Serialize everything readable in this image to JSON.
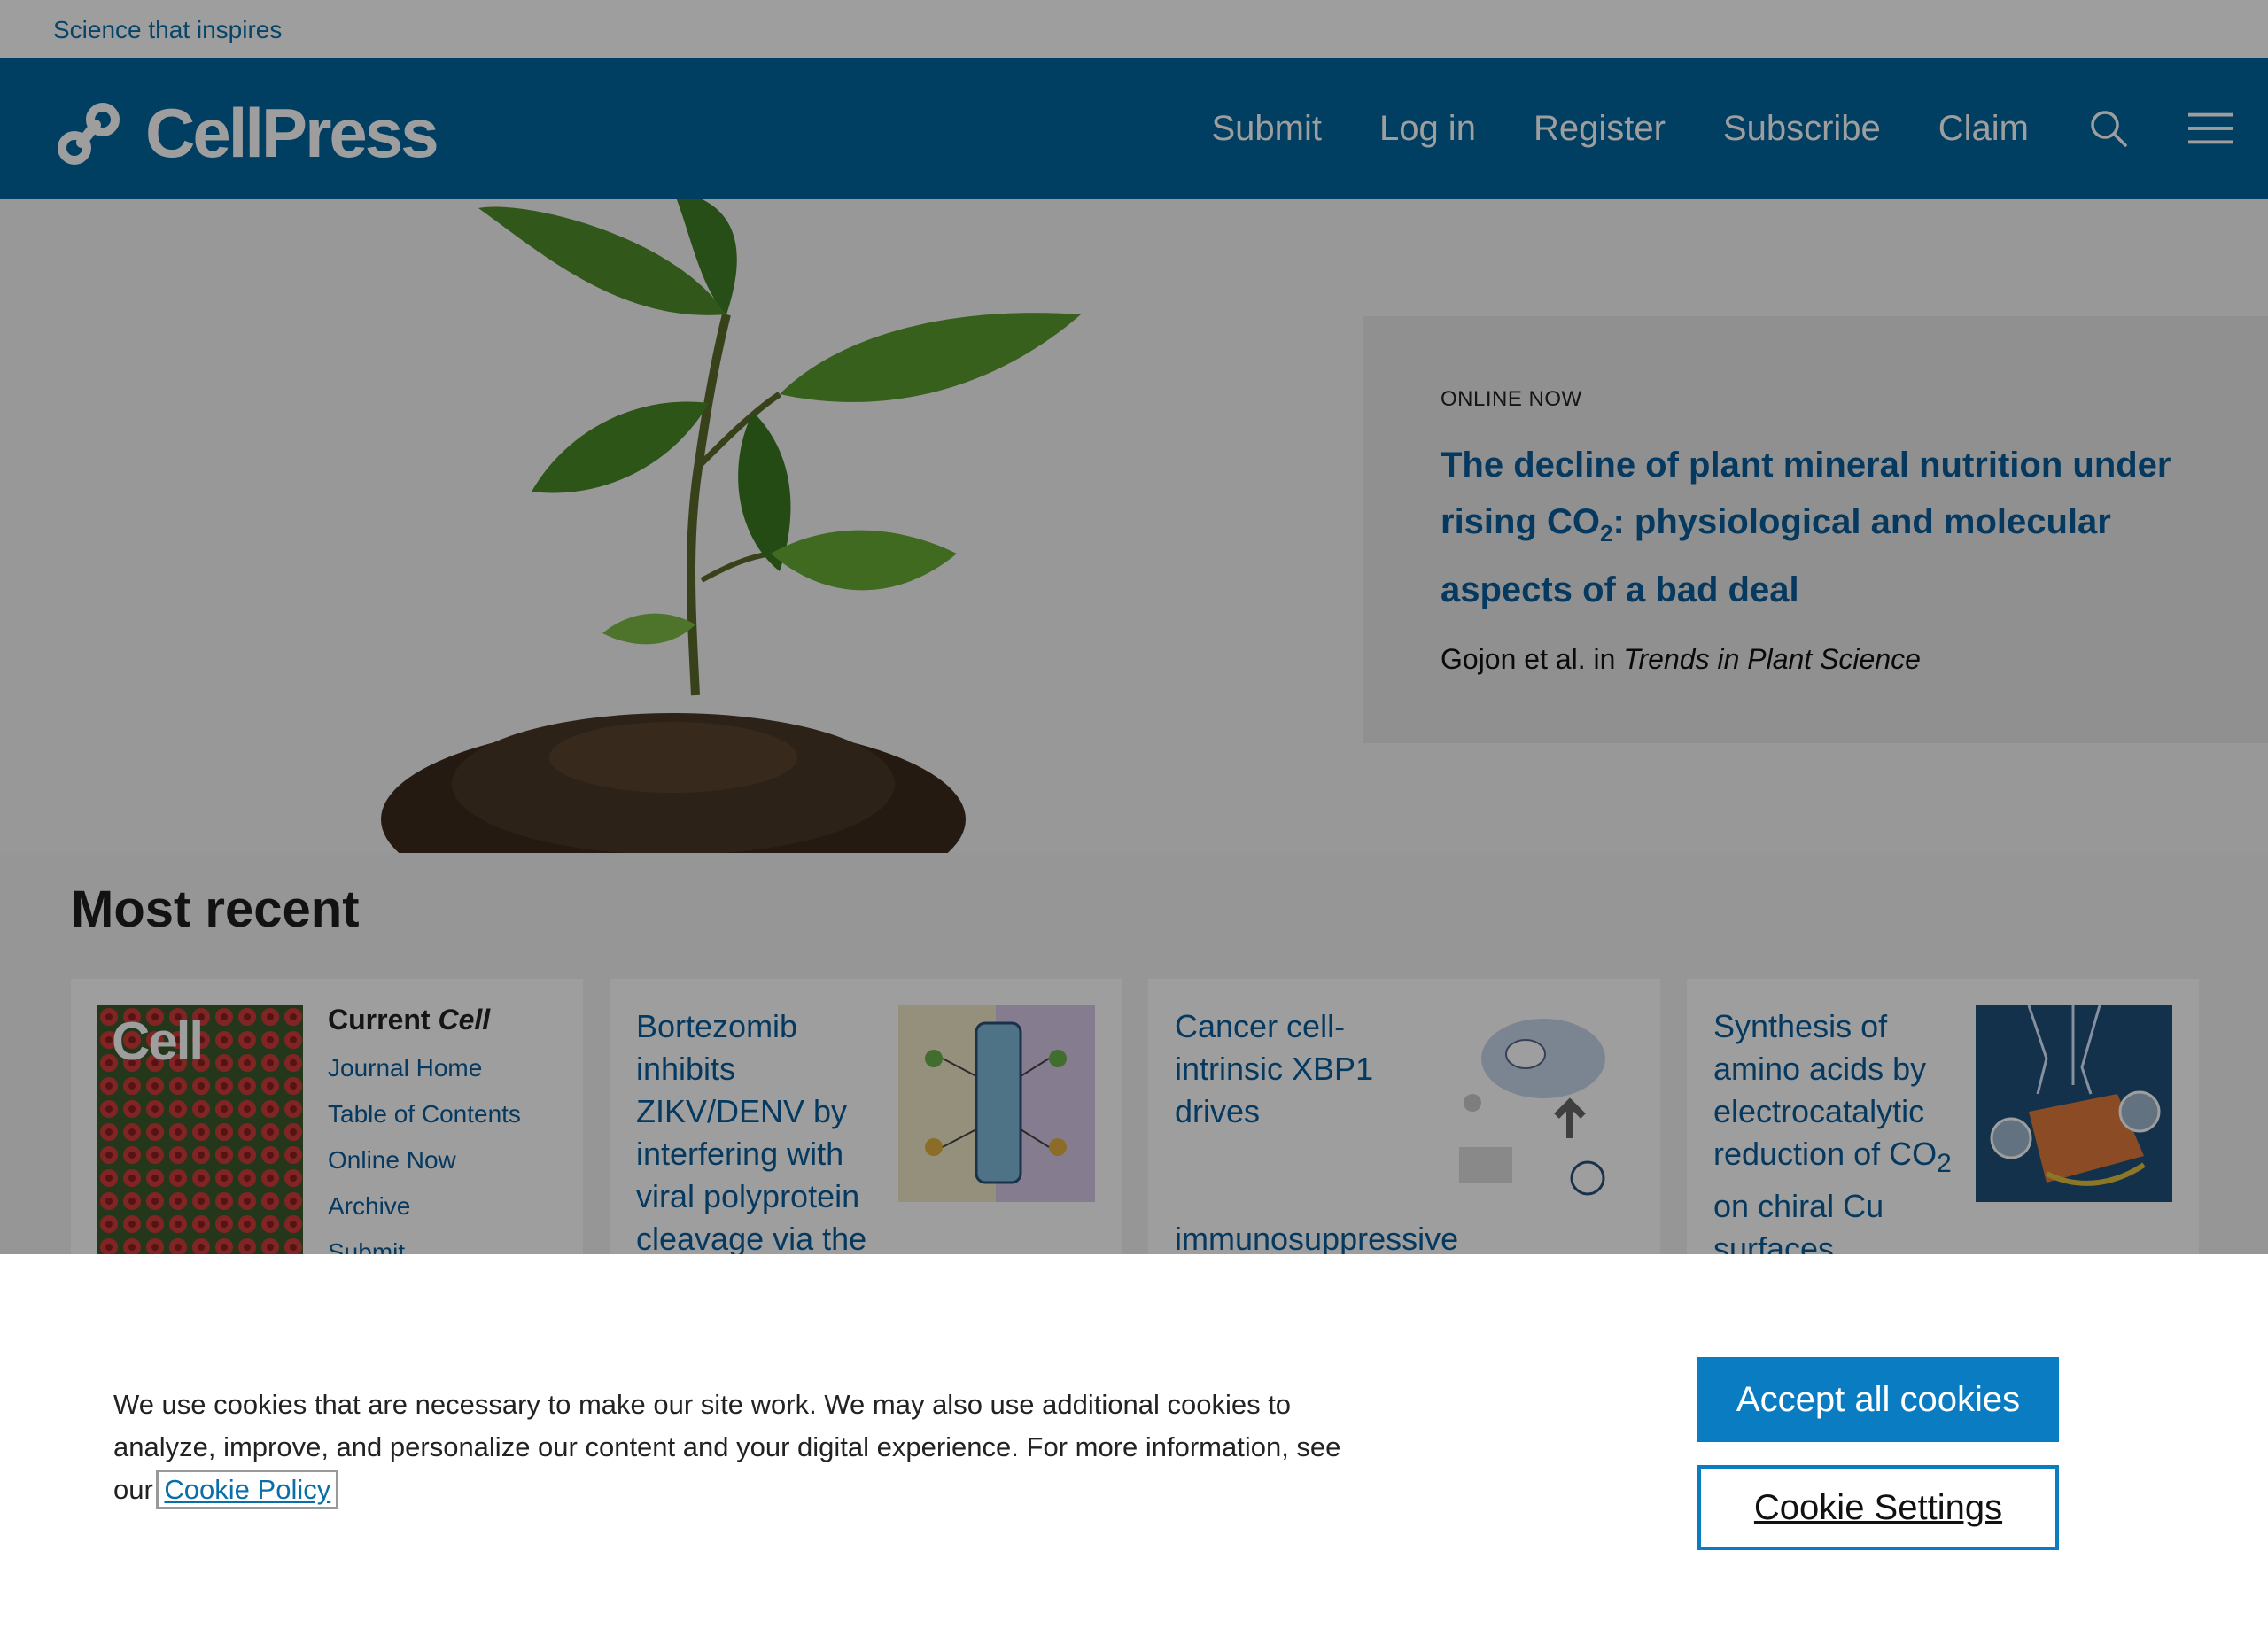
{
  "topbar": {
    "tagline": "Science that inspires"
  },
  "header": {
    "logo_text": "CellPress",
    "nav": [
      "Submit",
      "Log in",
      "Register",
      "Subscribe",
      "Claim"
    ],
    "icons": [
      "search-icon",
      "hamburger-menu-icon"
    ]
  },
  "hero": {
    "kicker": "ONLINE NOW",
    "headline_part1": "The decline of plant mineral nutrition under rising CO",
    "headline_sub": "2",
    "headline_part2": ": physiological and molecular aspects of a bad deal",
    "byline_prefix": "Gojon et al. in ",
    "byline_journal": "Trends in Plant Science"
  },
  "recent": {
    "heading": "Most recent",
    "journal_card": {
      "cover_title": "Cell",
      "title_prefix": "Current ",
      "title_journal": "Cell",
      "links": [
        "Journal Home",
        "Table of Contents",
        "Online Now",
        "Archive",
        "Submit"
      ]
    },
    "articles": [
      {
        "title": "Bortezomib inhibits ZIKV/DENV by interfering with viral polyprotein cleavage via the ERAD"
      },
      {
        "title_top": "Cancer cell-intrinsic XBP1 drives",
        "title_bottom": "immunosuppressive"
      },
      {
        "title_part1": "Synthesis of amino acids by electrocatalytic reduction of CO",
        "title_sub": "2",
        "title_part2": " on chiral Cu surfaces"
      }
    ]
  },
  "cookie": {
    "text": "We use cookies that are necessary to make our site work. We may also use additional cookies to analyze, improve, and personalize our content and your digital experience. For more information, see our ",
    "policy_link": "Cookie Policy",
    "accept_label": "Accept all cookies",
    "settings_label": "Cookie Settings"
  },
  "colors": {
    "brand_blue": "#00649f",
    "link_blue": "#0a5c99",
    "button_blue": "#0a7dc2"
  }
}
